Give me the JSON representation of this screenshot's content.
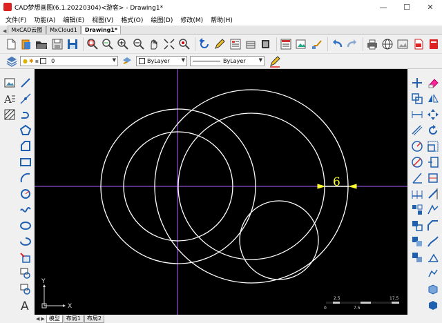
{
  "window": {
    "title": "CAD梦想画图(6.1.20220304)<游客> - Drawing1*",
    "minimize": "—",
    "maximize": "☐",
    "close": "✕"
  },
  "menu": [
    "文件(F)",
    "功能(A)",
    "编辑(E)",
    "视图(V)",
    "格式(O)",
    "绘图(D)",
    "修改(M)",
    "帮助(H)"
  ],
  "doc_tabs": [
    "MxCAD云图",
    "MxCloud1",
    "Drawing1*"
  ],
  "properties": {
    "layer_value": "0",
    "color_value": "ByLayer",
    "linetype_value": "ByLayer"
  },
  "canvas": {
    "dimension_text": "6",
    "ucs_x": "X",
    "ucs_y": "Y",
    "scale_labels_top": [
      "2.5",
      "17.5"
    ],
    "scale_labels_bottom": [
      "0",
      "7.5"
    ]
  },
  "layout_tabs": [
    "模型",
    "布局1",
    "布局2"
  ],
  "colors": {
    "canvas_bg": "#000000",
    "entity": "#ffffff",
    "axis": "#b060ff",
    "dimension": "#ffff33"
  }
}
